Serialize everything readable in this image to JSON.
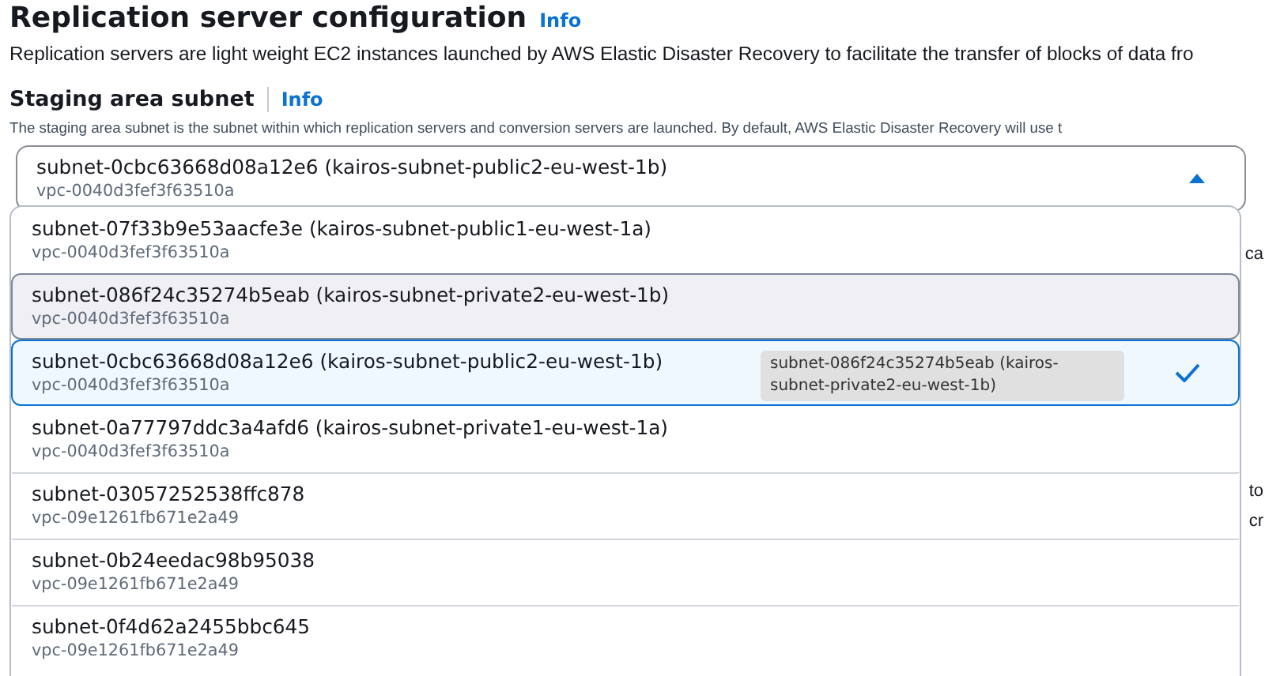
{
  "section": {
    "title": "Replication server configuration",
    "info_link": "Info",
    "description": "Replication servers are light weight EC2 instances launched by AWS Elastic Disaster Recovery to facilitate the transfer of blocks of data fro"
  },
  "field": {
    "label": "Staging area subnet",
    "info_link": "Info",
    "hint": "The staging area subnet is the subnet within which replication servers and conversion servers are launched. By default, AWS Elastic Disaster Recovery will use t",
    "value": "subnet-0cbc63668d08a12e6 (kairos-subnet-public2-eu-west-1b)",
    "value_detail": "vpc-0040d3fef3f63510a",
    "expanded": true
  },
  "options": [
    {
      "label": "subnet-07f33b9e53aacfe3e (kairos-subnet-public1-eu-west-1a)",
      "detail": "vpc-0040d3fef3f63510a",
      "selected": false,
      "hovered": false
    },
    {
      "label": "subnet-086f24c35274b5eab (kairos-subnet-private2-eu-west-1b)",
      "detail": "vpc-0040d3fef3f63510a",
      "selected": false,
      "hovered": true
    },
    {
      "label": "subnet-0cbc63668d08a12e6 (kairos-subnet-public2-eu-west-1b)",
      "detail": "vpc-0040d3fef3f63510a",
      "selected": true,
      "hovered": false
    },
    {
      "label": "subnet-0a77797ddc3a4afd6 (kairos-subnet-private1-eu-west-1a)",
      "detail": "vpc-0040d3fef3f63510a",
      "selected": false,
      "hovered": false
    },
    {
      "label": "subnet-03057252538ffc878",
      "detail": "vpc-09e1261fb671e2a49",
      "selected": false,
      "hovered": false
    },
    {
      "label": "subnet-0b24eedac98b95038",
      "detail": "vpc-09e1261fb671e2a49",
      "selected": false,
      "hovered": false
    },
    {
      "label": "subnet-0f4d62a2455bbc645",
      "detail": "vpc-09e1261fb671e2a49",
      "selected": false,
      "hovered": false
    }
  ],
  "tooltip": {
    "text": "subnet-086f24c35274b5eab (kairos-subnet-private2-eu-west-1b)"
  },
  "background_fragments": [
    "ca",
    "to",
    "cr"
  ]
}
